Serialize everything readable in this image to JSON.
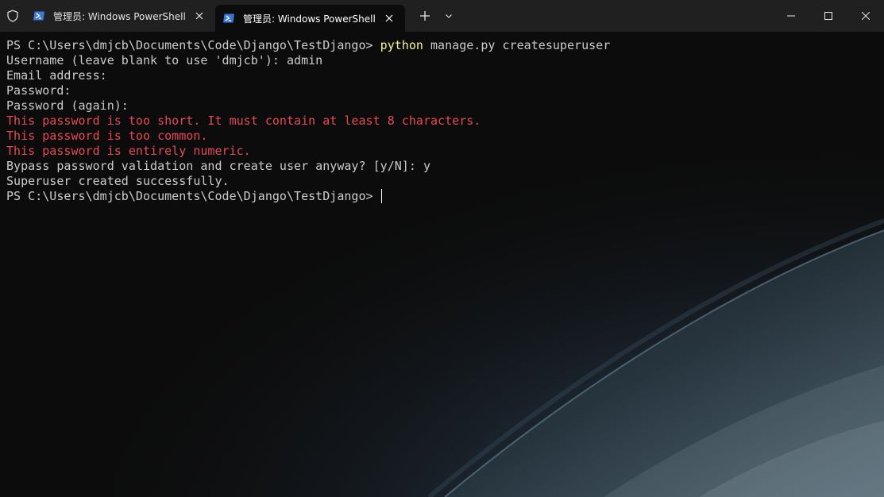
{
  "tabs": [
    {
      "title": "管理员: Windows PowerShell",
      "active": false
    },
    {
      "title": "管理员: Windows PowerShell",
      "active": true
    }
  ],
  "icons": {
    "shield": "shield-icon",
    "powershell": "powershell-icon",
    "close": "close-icon",
    "new_tab": "plus-icon",
    "dropdown": "chevron-down-icon",
    "minimize": "minimize-icon",
    "maximize": "maximize-icon",
    "window_close": "close-icon"
  },
  "colors": {
    "titlebar": "#202020",
    "terminal_bg": "#0c0c0c",
    "foreground": "#cccccc",
    "command": "#f9f1a5",
    "error": "#e74856",
    "powershell_icon": "#3b78d8"
  },
  "terminal": {
    "prompt": "PS C:\\Users\\dmjcb\\Documents\\Code\\Django\\TestDjango> ",
    "command_exe": "python",
    "command_args": " manage.py createsuperuser",
    "lines": [
      "Username (leave blank to use 'dmjcb'): admin",
      "Email address:",
      "Password:",
      "Password (again):"
    ],
    "errors": [
      "This password is too short. It must contain at least 8 characters.",
      "This password is too common.",
      "This password is entirely numeric."
    ],
    "bypass_prompt": "Bypass password validation and create user anyway? [y/N]: y",
    "success": "Superuser created successfully.",
    "final_prompt": "PS C:\\Users\\dmjcb\\Documents\\Code\\Django\\TestDjango> "
  }
}
